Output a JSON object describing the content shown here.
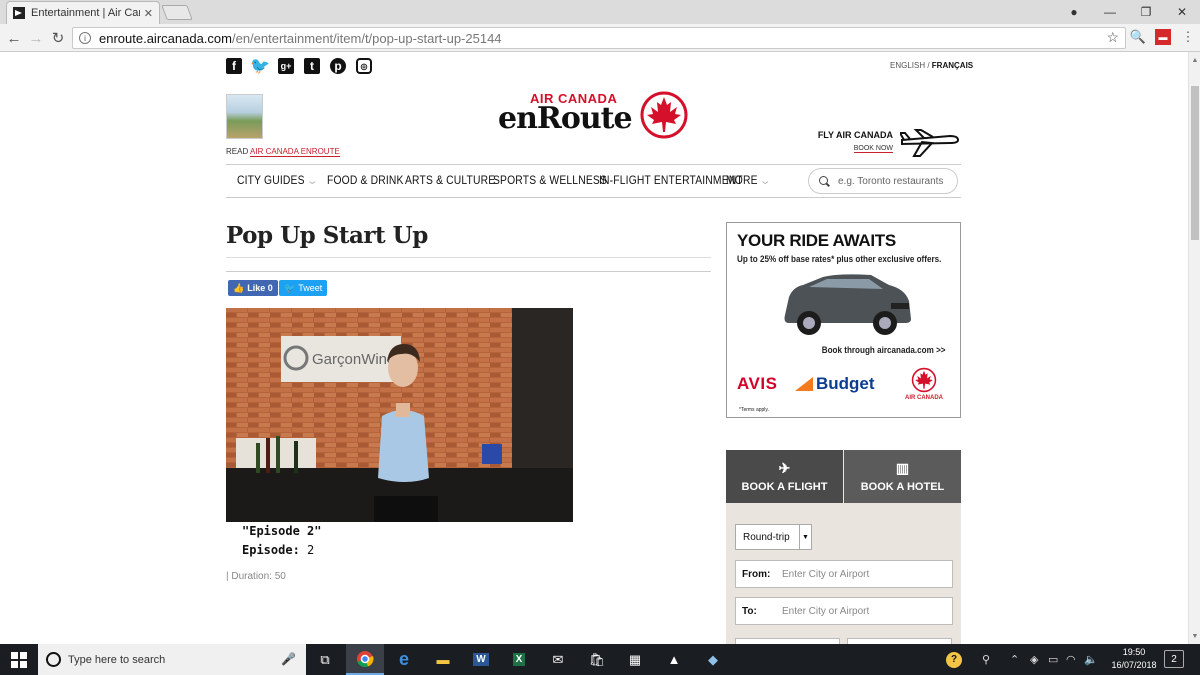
{
  "browser": {
    "tab_title": "Entertainment | Air Canada",
    "url_host": "enroute.aircanada.com",
    "url_path": "/en/entertainment/item/t/pop-up-start-up-25144"
  },
  "header": {
    "lang_en": "ENGLISH",
    "lang_sep": " / ",
    "lang_fr": "FRANÇAIS",
    "read_prefix": "READ ",
    "read_link": "AIR CANADA ENROUTE",
    "logo_top": "AIR CANADA",
    "logo_main": "enRoute",
    "fly_title": "FLY AIR CANADA",
    "book_now": "BOOK NOW"
  },
  "nav": {
    "items": [
      "CITY GUIDES",
      "FOOD & DRINK",
      "ARTS & CULTURE",
      "SPORTS & WELLNESS",
      "IN-FLIGHT ENTERTAINMENT",
      "MORE"
    ],
    "search_placeholder": "e.g. Toronto restaurants"
  },
  "article": {
    "title": "Pop Up Start Up",
    "like_label": "Like 0",
    "tweet_label": "Tweet",
    "video_sign": "GarçonWines",
    "episode_title": "\"Episode 2\"",
    "episode_label": "Episode:",
    "episode_number": "2",
    "duration": "| Duration: 50"
  },
  "ad": {
    "title": "YOUR RIDE AWAITS",
    "subtitle": "Up to 25% off base rates* plus other exclusive offers.",
    "cta": "Book through aircanada.com >>",
    "avis": "AVIS",
    "budget": "Budget",
    "ac_small": "AIR CANADA",
    "terms": "*Terms apply."
  },
  "booking": {
    "tab_flight": "BOOK A FLIGHT",
    "tab_hotel": "BOOK A HOTEL",
    "trip_type": "Round-trip",
    "from_label": "From:",
    "from_placeholder": "Enter City or Airport",
    "to_label": "To:",
    "to_placeholder": "Enter City or Airport"
  },
  "taskbar": {
    "search_placeholder": "Type here to search",
    "time": "19:50",
    "date": "16/07/2018",
    "notifications": "2"
  },
  "colors": {
    "brand_red": "#d5102b",
    "facebook": "#4267b2",
    "twitter": "#1da1f2"
  }
}
